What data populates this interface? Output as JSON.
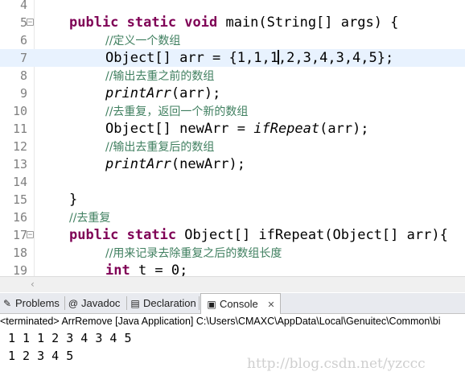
{
  "editor": {
    "lines": [
      {
        "num": "4",
        "fold": "",
        "current": false,
        "indent": 0,
        "tokens": []
      },
      {
        "num": "5",
        "fold": "⊖",
        "current": false,
        "indent": 1,
        "tokens": [
          {
            "t": "public static void",
            "c": "kw"
          },
          {
            "t": " main(String[] args) {",
            "c": ""
          }
        ]
      },
      {
        "num": "6",
        "fold": "",
        "current": false,
        "indent": 2,
        "tokens": [
          {
            "t": "//定义一个数组",
            "c": "cm"
          }
        ]
      },
      {
        "num": "7",
        "fold": "",
        "current": true,
        "indent": 2,
        "tokens": [
          {
            "t": "Object[] arr = {1,1,1",
            "c": ""
          },
          {
            "t": "",
            "c": "caret"
          },
          {
            "t": ",2,3,4,3,4,5};",
            "c": ""
          }
        ]
      },
      {
        "num": "8",
        "fold": "",
        "current": false,
        "indent": 2,
        "tokens": [
          {
            "t": "//输出去重之前的数组",
            "c": "cm"
          }
        ]
      },
      {
        "num": "9",
        "fold": "",
        "current": false,
        "indent": 2,
        "tokens": [
          {
            "t": "printArr",
            "c": "it"
          },
          {
            "t": "(arr);",
            "c": ""
          }
        ]
      },
      {
        "num": "10",
        "fold": "",
        "current": false,
        "indent": 2,
        "tokens": [
          {
            "t": "//去重复，返回一个新的数组",
            "c": "cm"
          }
        ]
      },
      {
        "num": "11",
        "fold": "",
        "current": false,
        "indent": 2,
        "tokens": [
          {
            "t": "Object[] newArr = ",
            "c": ""
          },
          {
            "t": "ifRepeat",
            "c": "it"
          },
          {
            "t": "(arr);",
            "c": ""
          }
        ]
      },
      {
        "num": "12",
        "fold": "",
        "current": false,
        "indent": 2,
        "tokens": [
          {
            "t": "//输出去重复后的数组",
            "c": "cm"
          }
        ]
      },
      {
        "num": "13",
        "fold": "",
        "current": false,
        "indent": 2,
        "tokens": [
          {
            "t": "printArr",
            "c": "it"
          },
          {
            "t": "(newArr);",
            "c": ""
          }
        ]
      },
      {
        "num": "14",
        "fold": "",
        "current": false,
        "indent": 0,
        "tokens": []
      },
      {
        "num": "15",
        "fold": "",
        "current": false,
        "indent": 1,
        "tokens": [
          {
            "t": "}",
            "c": ""
          }
        ]
      },
      {
        "num": "16",
        "fold": "",
        "current": false,
        "indent": 1,
        "tokens": [
          {
            "t": "//去重复",
            "c": "cm"
          }
        ]
      },
      {
        "num": "17",
        "fold": "⊖",
        "current": false,
        "indent": 1,
        "tokens": [
          {
            "t": "public static",
            "c": "kw"
          },
          {
            "t": " Object[] ifRepeat(Object[] arr){",
            "c": ""
          }
        ]
      },
      {
        "num": "18",
        "fold": "",
        "current": false,
        "indent": 2,
        "tokens": [
          {
            "t": "//用来记录去除重复之后的数组长度",
            "c": "cm"
          }
        ]
      },
      {
        "num": "19",
        "fold": "",
        "current": false,
        "indent": 2,
        "tokens": [
          {
            "t": "int",
            "c": "kw"
          },
          {
            "t": " t = 0;",
            "c": ""
          }
        ]
      }
    ]
  },
  "tabs": [
    {
      "icon": "✎",
      "icon_name": "problems-icon",
      "label": "Problems",
      "active": false
    },
    {
      "icon": "@",
      "icon_name": "javadoc-icon",
      "label": "Javadoc",
      "active": false
    },
    {
      "icon": "▤",
      "icon_name": "declaration-icon",
      "label": "Declaration",
      "active": false
    },
    {
      "icon": "▣",
      "icon_name": "console-icon",
      "label": "Console",
      "close": "✕",
      "active": true
    }
  ],
  "console": {
    "status": "<terminated> ArrRemove [Java Application] C:\\Users\\CMAXC\\AppData\\Local\\Genuitec\\Common\\bi",
    "output": [
      "1 1 1 2 3 4 3 4 5",
      "1 2 3 4 5"
    ]
  },
  "watermark": "http://blog.csdn.net/yzccc",
  "colors": {
    "keyword": "#7f0055",
    "comment": "#3f7f5f",
    "current_line": "#e8f2fe",
    "line_number": "#808080"
  }
}
